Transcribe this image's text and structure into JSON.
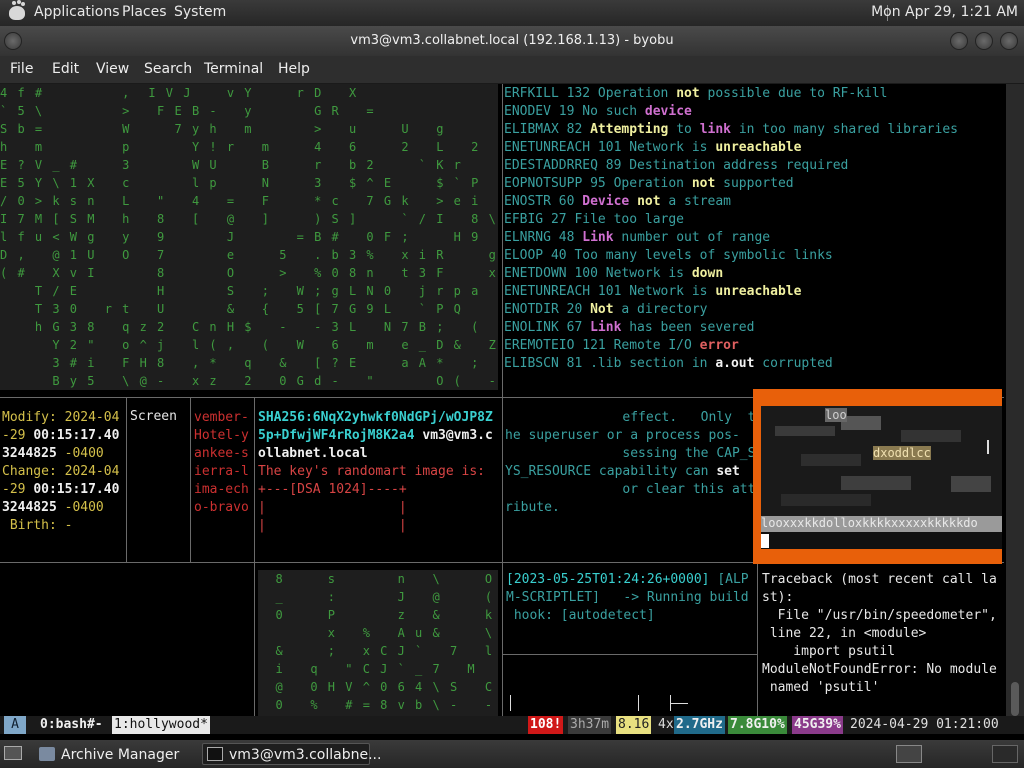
{
  "panel": {
    "menus": [
      "Applications",
      "Places",
      "System"
    ],
    "clock": "Mon Apr 29,  1:21 AM"
  },
  "window": {
    "title": "vm3@vm3.collabnet.local (192.168.1.13) - byobu"
  },
  "menubar": [
    "File",
    "Edit",
    "View",
    "Search",
    "Terminal",
    "Help"
  ],
  "matrix_top": [
    "4 f #         ,  I V J    v Y     r D   X",
    "` 5 \\         >   F E B -   y       G R   =",
    "S b =         W     7 y h   m       >   u     U   g",
    "h   m         p       Y ! r   m     4   6     2   L   2",
    "E ? V _ #     3       W U     B     r   b 2     ` K r",
    "E 5 Y \\ 1 X   c       l p     N     3   $ ^ E     $ ` P",
    "/ 0 > k s n   L   \"   4   =   F     * c   7 G k   > e i",
    "I 7 M [ S M   h   8   [   @   ]     ) S ]     ` / I   8 \\ c",
    "l f u < W g   y   9       J       = B #   0 F ;     H 9",
    "D ,   @ 1 U   O   7       e     5   . b 3 %   x i R     g",
    "( #   X v I       8       O     >   % 0 8 n   t 3 F     x",
    "    T / E         H       S   ;   W ; g L N 0   j r p a   \"",
    "    T 3 0   r t   U       &   {   5 [ 7 G 9 L   ` P Q     \"",
    "    h G 3 8   q z 2   C n H $   -   - 3 L   N 7 B ;   (",
    "      Y 2 \"   o ^ j   l ( ,   (   W   6   m   e _ D &   Z",
    "      3 # i   F H 8   , *   q   &   [ ? E     a A *   ;",
    "      B y 5   \\ @ -   x z   2   0 G d -   \"       O (   -"
  ],
  "errno_lines": [
    [
      [
        "ERFKILL 132 Operation ",
        ""
      ],
      [
        "not",
        "y"
      ],
      [
        " possible due to RF-kill",
        ""
      ]
    ],
    [
      [
        "ENODEV 19 No such ",
        ""
      ],
      [
        "device",
        "m"
      ]
    ],
    [
      [
        "ELIBMAX 82 ",
        ""
      ],
      [
        "Attempting",
        "y"
      ],
      [
        " to ",
        ""
      ],
      [
        "link",
        "m"
      ],
      [
        " in too many shared libraries",
        ""
      ]
    ],
    [
      [
        "ENETUNREACH 101 Network is ",
        ""
      ],
      [
        "unreachable",
        "y"
      ]
    ],
    [
      [
        "EDESTADDRREQ 89 Destination address required",
        ""
      ]
    ],
    [
      [
        "EOPNOTSUPP 95 Operation ",
        ""
      ],
      [
        "not",
        "y"
      ],
      [
        " supported",
        ""
      ]
    ],
    [
      [
        "ENOSTR 60 ",
        ""
      ],
      [
        "Device",
        "m"
      ],
      [
        " ",
        ""
      ],
      [
        "not",
        "y"
      ],
      [
        " a stream",
        ""
      ]
    ],
    [
      [
        "EFBIG 27 File too large",
        ""
      ]
    ],
    [
      [
        "ELNRNG 48 ",
        ""
      ],
      [
        "Link",
        "m"
      ],
      [
        " number out of range",
        ""
      ]
    ],
    [
      [
        "ELOOP 40 Too many levels of symbolic links",
        ""
      ]
    ],
    [
      [
        "ENETDOWN 100 Network is ",
        ""
      ],
      [
        "down",
        "y"
      ]
    ],
    [
      [
        "ENETUNREACH 101 Network is ",
        ""
      ],
      [
        "unreachable",
        "y"
      ]
    ],
    [
      [
        "ENOTDIR 20 ",
        ""
      ],
      [
        "Not",
        "y"
      ],
      [
        " a directory",
        ""
      ]
    ],
    [
      [
        "ENOLINK 67 ",
        ""
      ],
      [
        "Link",
        "m"
      ],
      [
        " has been severed",
        ""
      ]
    ],
    [
      [
        "EREMOTEIO 121 Remote I/O ",
        ""
      ],
      [
        "error",
        "r"
      ]
    ],
    [
      [
        "ELIBSCN 81 .lib section in ",
        ""
      ],
      [
        "a.out",
        "b"
      ],
      [
        " corrupted",
        ""
      ]
    ]
  ],
  "stat_lines": [
    [
      [
        "Modify: 2024-04",
        "y"
      ]
    ],
    [
      [
        "-29 ",
        "y"
      ],
      [
        "00:15:17.40",
        "b"
      ]
    ],
    [
      [
        "3244825",
        "b"
      ],
      [
        " -0400",
        "y"
      ]
    ],
    [
      [
        "Change: 2024-04",
        "y"
      ]
    ],
    [
      [
        "-29 ",
        "y"
      ],
      [
        "00:15:17.40",
        "b"
      ]
    ],
    [
      [
        "3244825",
        "b"
      ],
      [
        " -0400",
        "y"
      ]
    ],
    [
      [
        " Birth: -",
        "y"
      ]
    ]
  ],
  "screen_label": "Screen",
  "nato_lines": [
    "vember-",
    "Hotel-y",
    "ankee-s",
    "ierra-l",
    "ima-ech",
    "o-bravo"
  ],
  "ssh_lines": [
    [
      [
        "SHA256:6NqX2yhwkf0NdGPj/wOJP8Z",
        "cb"
      ]
    ],
    [
      [
        "5p+DfwjWF4rRojM8K2a4",
        "cb"
      ],
      [
        " vm3@vm3.c",
        "w"
      ]
    ],
    [
      [
        "ollabnet.local",
        "w"
      ]
    ],
    [
      [
        "The key's randomart image is:",
        "r"
      ]
    ],
    [
      [
        "+---[DSA 1024]----+",
        "r"
      ]
    ],
    [
      [
        "|                 |",
        "r"
      ]
    ],
    [
      [
        "|                 |",
        "r"
      ]
    ]
  ],
  "man_lines": [
    [
      [
        "               effect.   Only  t",
        ""
      ]
    ],
    [
      [
        "he superuser or a process pos-",
        ""
      ]
    ],
    [
      [
        "               sessing the CAP_S",
        ""
      ]
    ],
    [
      [
        "YS_RESOURCE capability can ",
        ""
      ],
      [
        "set",
        "b"
      ]
    ],
    [
      [
        "               or clear this att",
        ""
      ]
    ],
    [
      [
        "ribute.",
        ""
      ]
    ]
  ],
  "matrix_bottom": [
    "  8     s       n   \\     O",
    "  _     :       J   @     (   -",
    "  0     P       z   &     k   z",
    "        x   %   A u &     \\   W",
    "  &     ;   x C J `   7   l   s",
    "  i   q   \" C J ` _ 7   M     \"",
    "  @   0 H V ^ 0 6 4 \\ S   C   k",
    "  0   %   # = 8 v b \\ -   -   6"
  ],
  "log_lines": [
    [
      [
        "[2023-05-25T01:24:26+0000]",
        "w"
      ],
      [
        " [ALP",
        ""
      ]
    ],
    [
      [
        "M-SCRIPTLET]   -> Running build",
        ""
      ]
    ],
    [
      [
        " hook: [autodetect]",
        ""
      ]
    ]
  ],
  "traceback_lines": [
    "Traceback (most recent call la",
    "st):",
    "  File \"/usr/bin/speedometer\",",
    " line 22, in <module>",
    "    import psutil",
    "ModuleNotFoundError: No module",
    " named 'psutil'"
  ],
  "overlay_text": {
    "line1": "loo",
    "line2": "dxoddlcc",
    "line3": "looxxxkkdolloxkkkkxxxxxkkkkkdo"
  },
  "status": {
    "session": "A",
    "win0": "0:bash#-",
    "win1": "1:hollywood*",
    "updates": "108!",
    "uptime": "3h37m",
    "load": "8.16",
    "cpu_count": "4x",
    "cpu_freq": "2.7GHz",
    "mem": "7.8G10%",
    "disk": "45G39%",
    "datetime": "2024-04-29 01:21:00"
  },
  "taskbar": [
    {
      "label": "Archive Manager"
    },
    {
      "label": "vm3@vm3.collabne..."
    }
  ]
}
